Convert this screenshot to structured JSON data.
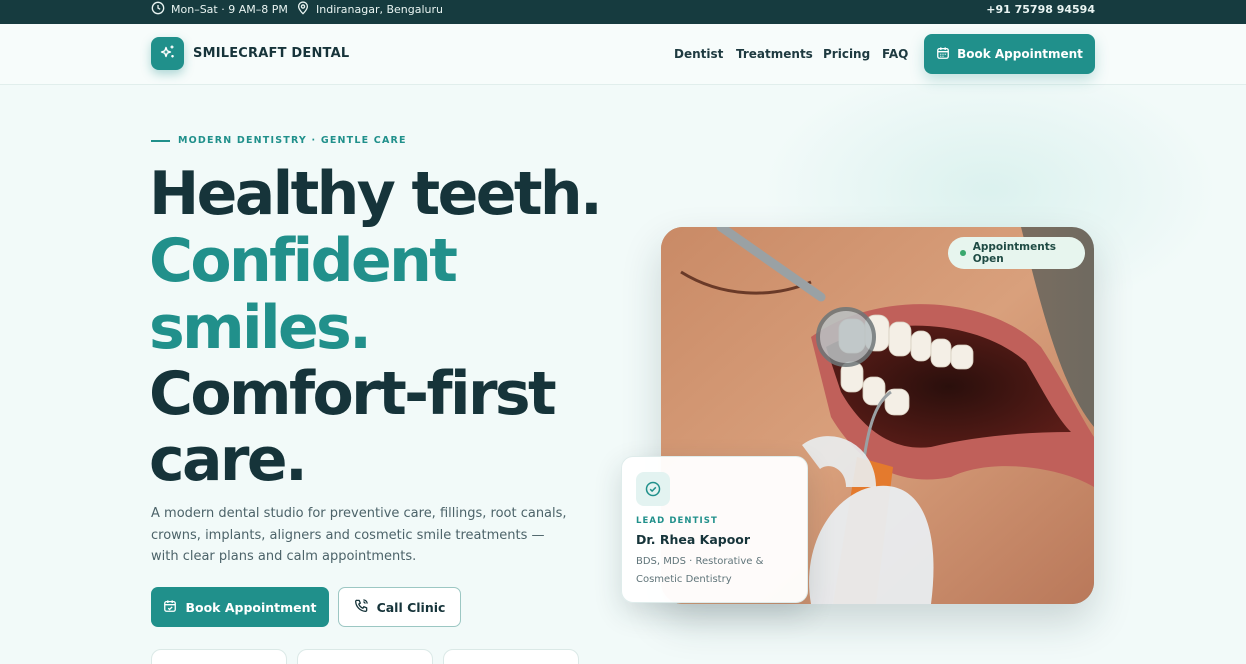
{
  "topbar": {
    "hours": "Mon–Sat · 9 AM–8 PM",
    "location": "Indiranagar, Bengaluru",
    "phone": "+91 75798 94594"
  },
  "header": {
    "brand": "SMILECRAFT DENTAL",
    "nav": [
      "Dentist",
      "Treatments",
      "Pricing",
      "FAQ"
    ],
    "cta": "Book Appointment"
  },
  "hero": {
    "eyebrow": "MODERN DENTISTRY · GENTLE CARE",
    "headline": [
      "Healthy teeth.",
      "Confident",
      "smiles.",
      "Comfort-first",
      "care."
    ],
    "lede": "A modern dental studio for preventive care, fillings, root canals, crowns, implants, aligners and cosmetic smile treatments — with clear plans and calm appointments.",
    "primary_cta": "Book Appointment",
    "secondary_cta": "Call Clinic",
    "status_badge": "Appointments Open",
    "dentist_card": {
      "role": "LEAD DENTIST",
      "name": "Dr. Rhea Kapoor",
      "credentials": "BDS, MDS · Restorative & Cosmetic Dentistry"
    }
  },
  "colors": {
    "accent": "#20908b",
    "dark": "#163b3f",
    "background": "#f2faf9"
  }
}
